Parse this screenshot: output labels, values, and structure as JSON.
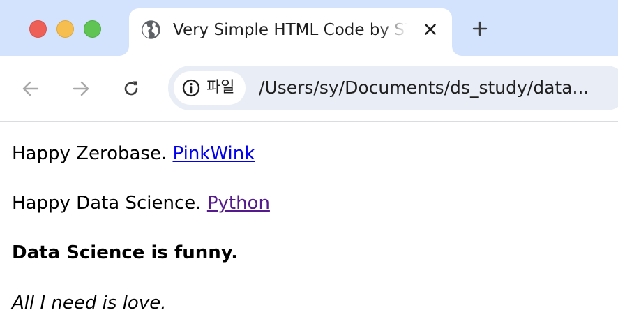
{
  "browser": {
    "tab": {
      "title": "Very Simple HTML Code by ST",
      "icon": "globe-icon"
    },
    "new_tab_symbol": "+",
    "toolbar": {
      "site_chip_label": "파일",
      "url": "/Users/sy/Documents/ds_study/data..."
    },
    "colors": {
      "tabstrip_bg": "#d3e3fd",
      "omnibox_bg": "#e9eef6",
      "link_unvisited": "#0000ee",
      "link_visited": "#551a8b"
    }
  },
  "page": {
    "line1": {
      "text": "Happy Zerobase. ",
      "link": "PinkWink"
    },
    "line2": {
      "text": "Happy Data Science. ",
      "link": "Python"
    },
    "line3": "Data Science is funny.",
    "line4": "All I need is love."
  }
}
